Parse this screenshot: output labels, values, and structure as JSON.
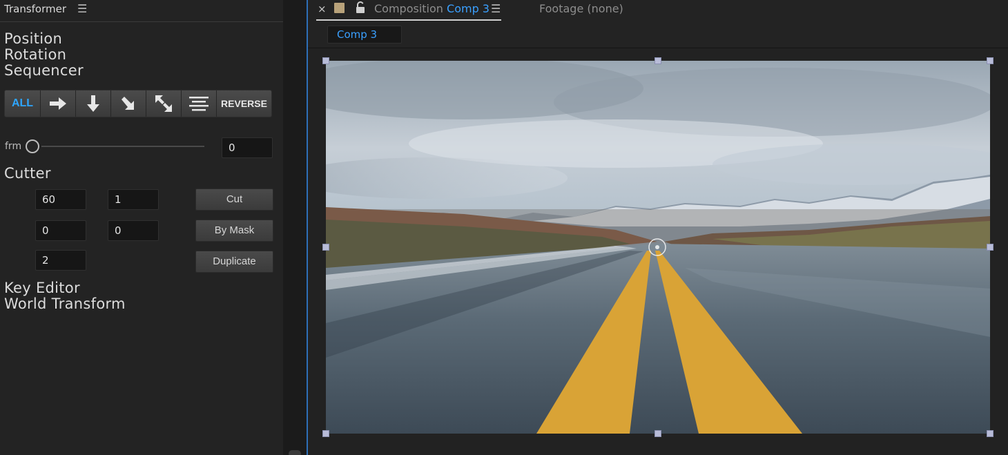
{
  "panel": {
    "title": "Transformer",
    "menu_icon": "hamburger-menu-icon"
  },
  "sections": {
    "position": "Position",
    "rotation": "Rotation",
    "sequencer": "Sequencer",
    "cutter": "Cutter",
    "key_editor": "Key Editor",
    "world_transform": "World Transform"
  },
  "sequencer": {
    "all_label": "ALL",
    "reverse_label": "REVERSE",
    "icons": [
      "arrow-right-icon",
      "arrow-down-icon",
      "arrow-down-right-icon",
      "arrow-diagonal-expand-icon",
      "align-center-lines-icon"
    ],
    "frm_label": "frm",
    "frm_value": "0",
    "slider_fraction": 0
  },
  "cutter": {
    "fields": [
      [
        "60",
        "1"
      ],
      [
        "0",
        "0"
      ],
      [
        "2"
      ]
    ],
    "buttons": {
      "cut": "Cut",
      "by_mask": "By Mask",
      "duplicate": "Duplicate"
    }
  },
  "viewer": {
    "close": "×",
    "tab_prefix": "Composition",
    "comp_name": "Comp 3",
    "footage_label": "Footage",
    "footage_value": "(none)",
    "subtab": "Comp 3",
    "accent_color": "#3aa0ff",
    "label_color": "#b8a27a"
  },
  "colors": {
    "accent": "#2ea6ff",
    "background": "#232323"
  }
}
